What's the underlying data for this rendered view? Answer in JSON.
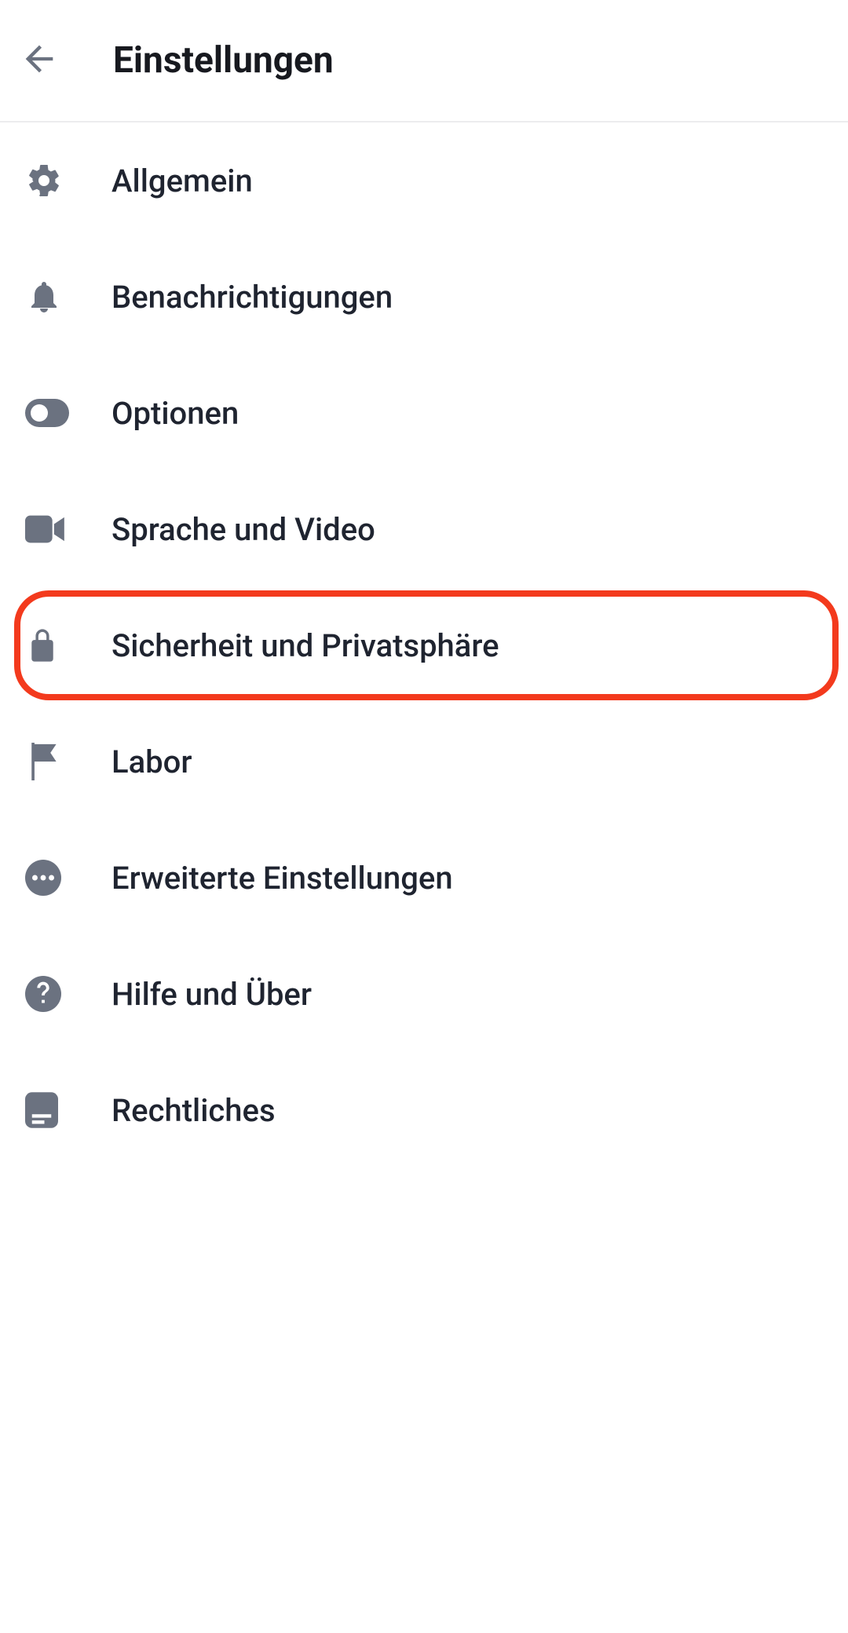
{
  "header": {
    "title": "Einstellungen"
  },
  "items": [
    {
      "label": "Allgemein"
    },
    {
      "label": "Benachrichtigungen"
    },
    {
      "label": "Optionen"
    },
    {
      "label": "Sprache und Video"
    },
    {
      "label": "Sicherheit und Privatsphäre"
    },
    {
      "label": "Labor"
    },
    {
      "label": "Erweiterte Einstellungen"
    },
    {
      "label": "Hilfe und Über"
    },
    {
      "label": "Rechtliches"
    }
  ]
}
